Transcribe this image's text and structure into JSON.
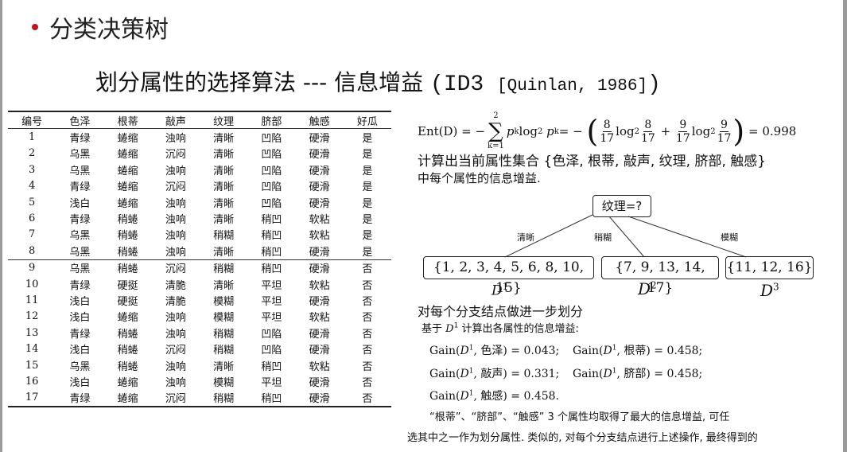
{
  "slide": {
    "heading": "分类决策树",
    "subtitle_cn": "划分属性的选择算法 --- 信息增益 ",
    "subtitle_id3": "(ID3 ",
    "subtitle_ref": "[Quinlan, 1986]",
    "subtitle_close": ")"
  },
  "table": {
    "headers": [
      "编号",
      "色泽",
      "根蒂",
      "敲声",
      "纹理",
      "脐部",
      "触感",
      "好瓜"
    ],
    "rows": [
      [
        "1",
        "青绿",
        "蜷缩",
        "浊响",
        "清晰",
        "凹陷",
        "硬滑",
        "是"
      ],
      [
        "2",
        "乌黑",
        "蜷缩",
        "沉闷",
        "清晰",
        "凹陷",
        "硬滑",
        "是"
      ],
      [
        "3",
        "乌黑",
        "蜷缩",
        "浊响",
        "清晰",
        "凹陷",
        "硬滑",
        "是"
      ],
      [
        "4",
        "青绿",
        "蜷缩",
        "沉闷",
        "清晰",
        "凹陷",
        "硬滑",
        "是"
      ],
      [
        "5",
        "浅白",
        "蜷缩",
        "浊响",
        "清晰",
        "凹陷",
        "硬滑",
        "是"
      ],
      [
        "6",
        "青绿",
        "稍蜷",
        "浊响",
        "清晰",
        "稍凹",
        "软粘",
        "是"
      ],
      [
        "7",
        "乌黑",
        "稍蜷",
        "浊响",
        "稍糊",
        "稍凹",
        "软粘",
        "是"
      ],
      [
        "8",
        "乌黑",
        "稍蜷",
        "浊响",
        "清晰",
        "稍凹",
        "硬滑",
        "是"
      ],
      [
        "9",
        "乌黑",
        "稍蜷",
        "沉闷",
        "稍糊",
        "稍凹",
        "硬滑",
        "否"
      ],
      [
        "10",
        "青绿",
        "硬挺",
        "清脆",
        "清晰",
        "平坦",
        "软粘",
        "否"
      ],
      [
        "11",
        "浅白",
        "硬挺",
        "清脆",
        "模糊",
        "平坦",
        "硬滑",
        "否"
      ],
      [
        "12",
        "浅白",
        "蜷缩",
        "浊响",
        "模糊",
        "平坦",
        "软粘",
        "否"
      ],
      [
        "13",
        "青绿",
        "稍蜷",
        "浊响",
        "稍糊",
        "凹陷",
        "硬滑",
        "否"
      ],
      [
        "14",
        "浅白",
        "稍蜷",
        "沉闷",
        "稍糊",
        "凹陷",
        "硬滑",
        "否"
      ],
      [
        "15",
        "乌黑",
        "稍蜷",
        "浊响",
        "清晰",
        "稍凹",
        "软粘",
        "否"
      ],
      [
        "16",
        "浅白",
        "蜷缩",
        "浊响",
        "模糊",
        "平坦",
        "硬滑",
        "否"
      ],
      [
        "17",
        "青绿",
        "蜷缩",
        "沉闷",
        "稍糊",
        "稍凹",
        "硬滑",
        "否"
      ]
    ]
  },
  "formula": {
    "lhs": "Ent(D) = −",
    "sum_top": "2",
    "sum_sym": "∑",
    "sum_bottom": "k=1",
    "term": "p",
    "sub_k": "k",
    "log": " log",
    "log_base": "2",
    "eq_neg": " = −",
    "open": "(",
    "close": ")",
    "f1_num": "8",
    "f1_den": "17",
    "f2_num": "8",
    "f2_den": "17",
    "plus": "+",
    "f3_num": "9",
    "f3_den": "17",
    "f4_num": "9",
    "f4_den": "17",
    "result": "= 0.998"
  },
  "text": {
    "line1": "计算出当前属性集合 {色泽, 根蒂, 敲声, 纹理, 脐部, 触感}",
    "line2": "中每个属性的信息增益.",
    "step": "对每个分支结点做进一步划分",
    "based_pre": "基于 ",
    "based_post": " 计算出各属性的信息增益:",
    "para1": "“根蒂”、“脐部”、“触感” 3 个属性均取得了最大的信息增益, 可任",
    "para2": "选其中之一作为划分属性. 类似的, 对每个分支结点进行上述操作, 最终得到的"
  },
  "tree": {
    "root": "纹理=?",
    "branches": [
      {
        "label": "清晰",
        "set": "{1, 2, 3, 4, 5, 6, 8, 10, 15}",
        "name": "D",
        "sup": "1"
      },
      {
        "label": "稍糊",
        "set": "{7, 9, 13, 14, 17}",
        "name": "D",
        "sup": "2"
      },
      {
        "label": "模糊",
        "set": "{11, 12, 16}",
        "name": "D",
        "sup": "3"
      }
    ]
  },
  "gains": [
    {
      "pre": "Gain(",
      "d": "D",
      "sup": "1",
      "attr": ", 色泽) = 0.043;"
    },
    {
      "pre": "Gain(",
      "d": "D",
      "sup": "1",
      "attr": ", 根蒂) = 0.458;"
    },
    {
      "pre": "Gain(",
      "d": "D",
      "sup": "1",
      "attr": ", 敲声) = 0.331;"
    },
    {
      "pre": "Gain(",
      "d": "D",
      "sup": "1",
      "attr": ", 脐部) = 0.458;"
    },
    {
      "pre": "Gain(",
      "d": "D",
      "sup": "1",
      "attr": ", 触感) = 0.458."
    }
  ],
  "colors": {
    "bullet": "#c0141c",
    "edge": "#9a9a9a"
  }
}
